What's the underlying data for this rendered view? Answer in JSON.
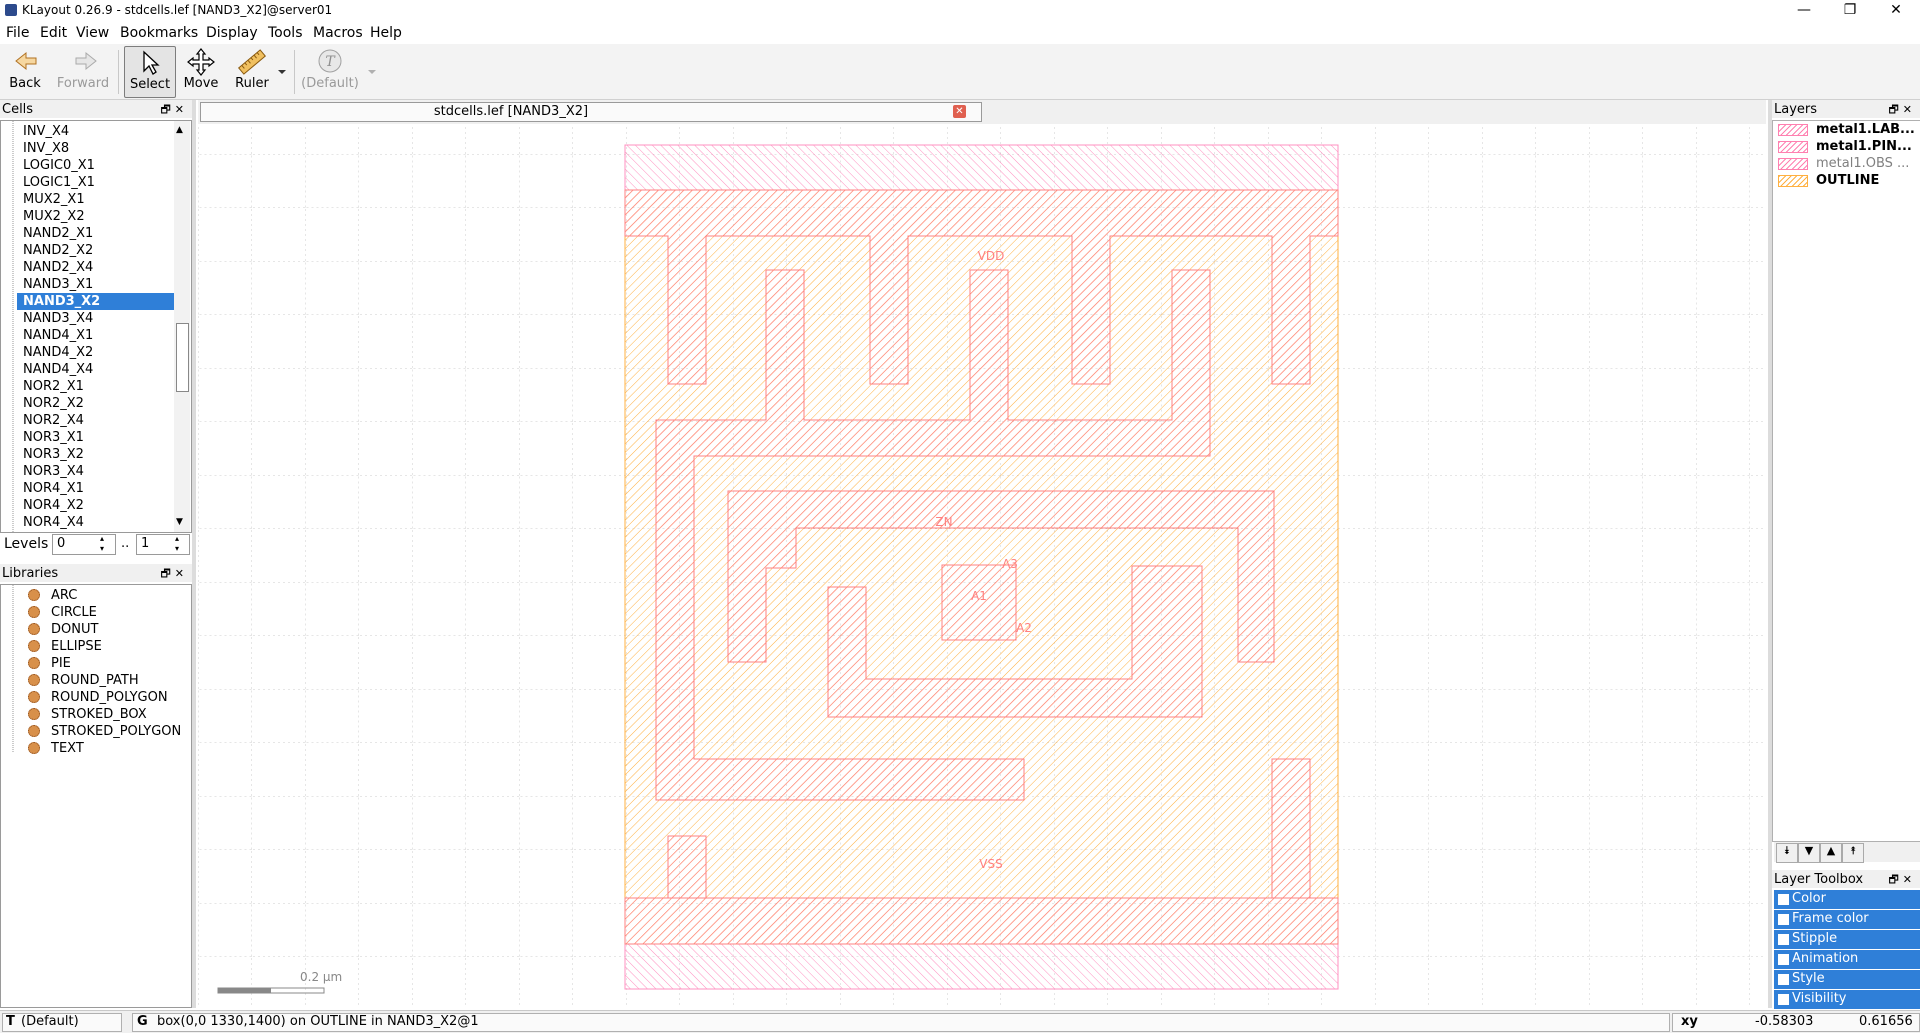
{
  "window": {
    "title": "KLayout 0.26.9 - stdcells.lef [NAND3_X2]@server01",
    "controls": [
      "—",
      "❐",
      "✕"
    ]
  },
  "menu": [
    "File",
    "Edit",
    "View",
    "Bookmarks",
    "Display",
    "Tools",
    "Macros",
    "Help"
  ],
  "toolbar": {
    "back": "Back",
    "forward": "Forward",
    "select": "Select",
    "move": "Move",
    "ruler": "Ruler",
    "default_mode": "(Default)"
  },
  "cells_panel": {
    "title": "Cells",
    "items": [
      "INV_X4",
      "INV_X8",
      "LOGIC0_X1",
      "LOGIC1_X1",
      "MUX2_X1",
      "MUX2_X2",
      "NAND2_X1",
      "NAND2_X2",
      "NAND2_X4",
      "NAND3_X1",
      "NAND3_X2",
      "NAND3_X4",
      "NAND4_X1",
      "NAND4_X2",
      "NAND4_X4",
      "NOR2_X1",
      "NOR2_X2",
      "NOR2_X4",
      "NOR3_X1",
      "NOR3_X2",
      "NOR3_X4",
      "NOR4_X1",
      "NOR4_X2",
      "NOR4_X4"
    ],
    "selected": "NAND3_X2",
    "levels_label": "Levels",
    "level_from": "0",
    "level_sep": "..",
    "level_to": "1"
  },
  "libraries_panel": {
    "title": "Libraries",
    "items": [
      "ARC",
      "CIRCLE",
      "DONUT",
      "ELLIPSE",
      "PIE",
      "ROUND_PATH",
      "ROUND_POLYGON",
      "STROKED_BOX",
      "STROKED_POLYGON",
      "TEXT"
    ]
  },
  "layout_tab": {
    "label": "stdcells.lef [NAND3_X2]"
  },
  "layout": {
    "labels": {
      "vdd": "VDD",
      "vss": "VSS",
      "zn": "ZN",
      "a1": "A1",
      "a2": "A2",
      "a3": "A3"
    },
    "scale_bar": "0.2 µm",
    "colors": {
      "metal": "#ff8080",
      "outline": "#ffb040",
      "grid": "#c8c8c8"
    }
  },
  "layers_panel": {
    "title": "Layers",
    "items": [
      {
        "label": "metal1.LAB...",
        "bold": true,
        "color": "#ff80b0"
      },
      {
        "label": "metal1.PIN...",
        "bold": true,
        "color": "#ff80b0"
      },
      {
        "label": "metal1.OBS ...",
        "bold": false,
        "color": "#ff80b0"
      },
      {
        "label": "OUTLINE",
        "bold": true,
        "color": "#ffb040"
      }
    ]
  },
  "layer_toolbox": {
    "title": "Layer Toolbox",
    "items": [
      "Color",
      "Frame color",
      "Stipple",
      "Animation",
      "Style",
      "Visibility"
    ]
  },
  "status_bar": {
    "mode_icon": "T",
    "mode": "(Default)",
    "g_icon": "G",
    "message": "box(0,0 1330,1400) on OUTLINE in NAND3_X2@1",
    "coord_label": "xy",
    "x": "-0.58303",
    "y": "0.61656"
  }
}
